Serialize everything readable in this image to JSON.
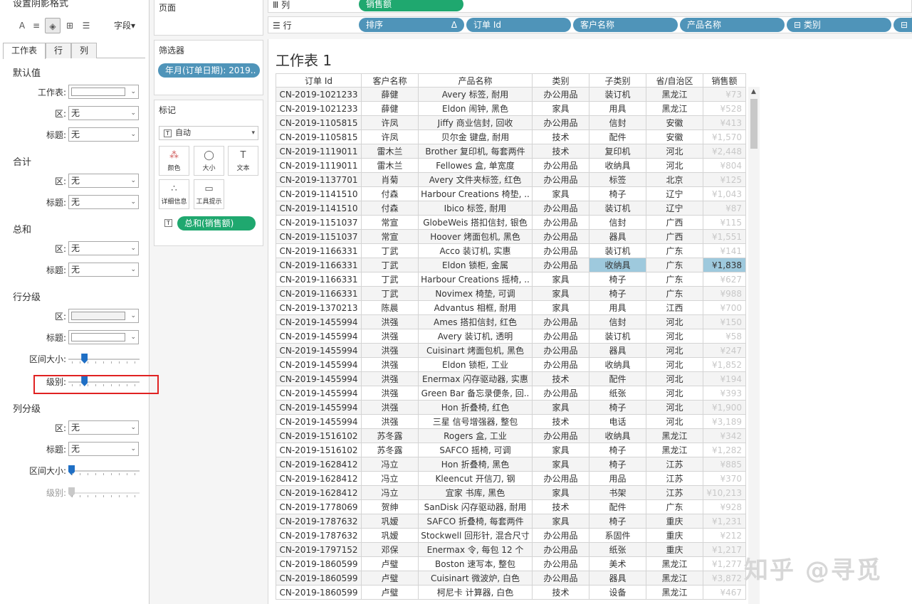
{
  "format_pane": {
    "title": "设置阴影格式",
    "field_button": "字段▾",
    "tabs": [
      "工作表",
      "行",
      "列"
    ],
    "sections": {
      "default": {
        "heading": "默认值",
        "worksheet_label": "工作表:",
        "pane_label": "区:",
        "pane_value": "无",
        "header_label": "标题:",
        "header_value": "无"
      },
      "total": {
        "heading": "合计",
        "pane_label": "区:",
        "pane_value": "无",
        "header_label": "标题:",
        "header_value": "无"
      },
      "grand_total": {
        "heading": "总和",
        "pane_label": "区:",
        "pane_value": "无",
        "header_label": "标题:",
        "header_value": "无"
      },
      "row_banding": {
        "heading": "行分级",
        "pane_label": "区:",
        "header_label": "标题:",
        "band_size_label": "区间大小:",
        "level_label": "级别:",
        "band_size_level": 0.2,
        "level_level": 0.2
      },
      "col_banding": {
        "heading": "列分级",
        "pane_label": "区:",
        "pane_value": "无",
        "header_label": "标题:",
        "header_value": "无",
        "band_size_label": "区间大小:",
        "level_label": "级别:",
        "band_size_level": 0.0,
        "level_level": 0.0
      }
    },
    "highlight_color": "#e02222"
  },
  "shelves": {
    "pages_label": "页面",
    "filters_label": "筛选器",
    "filter_pill": "年月(订单日期): 2019..",
    "marks_label": "标记",
    "mark_type": "自动",
    "mark_buttons": [
      "颜色",
      "大小",
      "文本",
      "详细信息",
      "工具提示"
    ],
    "measure_pill": "总和(销售额)",
    "columns_label": "列",
    "columns_pill": "销售额",
    "rows_label": "行",
    "rows_pills": [
      "排序",
      "订单 Id",
      "客户名称",
      "产品名称",
      "⊟ 类别",
      "⊟"
    ]
  },
  "sheet": {
    "title": "工作表 1",
    "headers": [
      "订单 Id",
      "客户名称",
      "产品名称",
      "类别",
      "子类别",
      "省/自治区",
      "销售额"
    ],
    "rows": [
      [
        "CN-2019-1021233",
        "薛健",
        "Avery 标签, 耐用",
        "办公用品",
        "装订机",
        "黑龙江",
        "¥73"
      ],
      [
        "CN-2019-1021233",
        "薛健",
        "Eldon 闹钟, 黑色",
        "家具",
        "用具",
        "黑龙江",
        "¥528"
      ],
      [
        "CN-2019-1105815",
        "许凤",
        "Jiffy 商业信封, 回收",
        "办公用品",
        "信封",
        "安徽",
        "¥413"
      ],
      [
        "CN-2019-1105815",
        "许凤",
        "贝尔金 键盘, 耐用",
        "技术",
        "配件",
        "安徽",
        "¥1,570"
      ],
      [
        "CN-2019-1119011",
        "雷木兰",
        "Brother 复印机, 每套两件",
        "技术",
        "复印机",
        "河北",
        "¥2,448"
      ],
      [
        "CN-2019-1119011",
        "雷木兰",
        "Fellowes 盒, 单宽度",
        "办公用品",
        "收纳具",
        "河北",
        "¥804"
      ],
      [
        "CN-2019-1137701",
        "肖菊",
        "Avery 文件夹标签, 红色",
        "办公用品",
        "标签",
        "北京",
        "¥125"
      ],
      [
        "CN-2019-1141510",
        "付森",
        "Harbour Creations 椅垫, ..",
        "家具",
        "椅子",
        "辽宁",
        "¥1,043"
      ],
      [
        "CN-2019-1141510",
        "付森",
        "Ibico 标签, 耐用",
        "办公用品",
        "装订机",
        "辽宁",
        "¥87"
      ],
      [
        "CN-2019-1151037",
        "常宣",
        "GlobeWeis 搭扣信封, 银色",
        "办公用品",
        "信封",
        "广西",
        "¥115"
      ],
      [
        "CN-2019-1151037",
        "常宣",
        "Hoover 烤面包机, 黑色",
        "办公用品",
        "器具",
        "广西",
        "¥1,551"
      ],
      [
        "CN-2019-1166331",
        "丁武",
        "Acco 装订机, 实惠",
        "办公用品",
        "装订机",
        "广东",
        "¥141"
      ],
      [
        "CN-2019-1166331",
        "丁武",
        "Eldon 锁柜, 金属",
        "办公用品",
        "收纳具",
        "广东",
        "¥1,838"
      ],
      [
        "CN-2019-1166331",
        "丁武",
        "Harbour Creations 摇椅, ..",
        "家具",
        "椅子",
        "广东",
        "¥627"
      ],
      [
        "CN-2019-1166331",
        "丁武",
        "Novimex 椅垫, 可调",
        "家具",
        "椅子",
        "广东",
        "¥988"
      ],
      [
        "CN-2019-1370213",
        "陈晨",
        "Advantus 相框, 耐用",
        "家具",
        "用具",
        "江西",
        "¥700"
      ],
      [
        "CN-2019-1455994",
        "洪强",
        "Ames 搭扣信封, 红色",
        "办公用品",
        "信封",
        "河北",
        "¥150"
      ],
      [
        "CN-2019-1455994",
        "洪强",
        "Avery 装订机, 透明",
        "办公用品",
        "装订机",
        "河北",
        "¥58"
      ],
      [
        "CN-2019-1455994",
        "洪强",
        "Cuisinart 烤面包机, 黑色",
        "办公用品",
        "器具",
        "河北",
        "¥247"
      ],
      [
        "CN-2019-1455994",
        "洪强",
        "Eldon 锁柜, 工业",
        "办公用品",
        "收纳具",
        "河北",
        "¥1,852"
      ],
      [
        "CN-2019-1455994",
        "洪强",
        "Enermax 闪存驱动器, 实惠",
        "技术",
        "配件",
        "河北",
        "¥194"
      ],
      [
        "CN-2019-1455994",
        "洪强",
        "Green Bar 备忘录便条, 回..",
        "办公用品",
        "纸张",
        "河北",
        "¥393"
      ],
      [
        "CN-2019-1455994",
        "洪强",
        "Hon 折叠椅, 红色",
        "家具",
        "椅子",
        "河北",
        "¥1,900"
      ],
      [
        "CN-2019-1455994",
        "洪强",
        "三星 信号增强器, 整包",
        "技术",
        "电话",
        "河北",
        "¥3,189"
      ],
      [
        "CN-2019-1516102",
        "苏冬露",
        "Rogers 盒, 工业",
        "办公用品",
        "收纳具",
        "黑龙江",
        "¥342"
      ],
      [
        "CN-2019-1516102",
        "苏冬露",
        "SAFCO 摇椅, 可调",
        "家具",
        "椅子",
        "黑龙江",
        "¥1,282"
      ],
      [
        "CN-2019-1628412",
        "冯立",
        "Hon 折叠椅, 黑色",
        "家具",
        "椅子",
        "江苏",
        "¥885"
      ],
      [
        "CN-2019-1628412",
        "冯立",
        "Kleencut 开信刀, 钢",
        "办公用品",
        "用品",
        "江苏",
        "¥370"
      ],
      [
        "CN-2019-1628412",
        "冯立",
        "宜家 书库, 黑色",
        "家具",
        "书架",
        "江苏",
        "¥10,213"
      ],
      [
        "CN-2019-1778069",
        "贺绅",
        "SanDisk 闪存驱动器, 耐用",
        "技术",
        "配件",
        "广东",
        "¥928"
      ],
      [
        "CN-2019-1787632",
        "巩嫒",
        "SAFCO 折叠椅, 每套两件",
        "家具",
        "椅子",
        "重庆",
        "¥1,231"
      ],
      [
        "CN-2019-1787632",
        "巩嫒",
        "Stockwell 回形针, 混合尺寸",
        "办公用品",
        "系固件",
        "重庆",
        "¥212"
      ],
      [
        "CN-2019-1797152",
        "邓保",
        "Enermax 令, 每包 12 个",
        "办公用品",
        "纸张",
        "重庆",
        "¥1,217"
      ],
      [
        "CN-2019-1860599",
        "卢璧",
        "Boston 速写本, 整包",
        "办公用品",
        "美术",
        "黑龙江",
        "¥1,277"
      ],
      [
        "CN-2019-1860599",
        "卢璧",
        "Cuisinart 微波炉, 白色",
        "办公用品",
        "器具",
        "黑龙江",
        "¥3,872"
      ],
      [
        "CN-2019-1860599",
        "卢璧",
        "柯尼卡 计算器, 白色",
        "技术",
        "设备",
        "黑龙江",
        "¥467"
      ]
    ],
    "highlight_row_index": 12
  },
  "watermark": "知乎 @寻觅",
  "colors": {
    "pill_blue": "#4f94b9",
    "pill_green": "#1fa86f",
    "slider_thumb": "#1f6fc5",
    "row_highlight": "#9ec9dd"
  }
}
